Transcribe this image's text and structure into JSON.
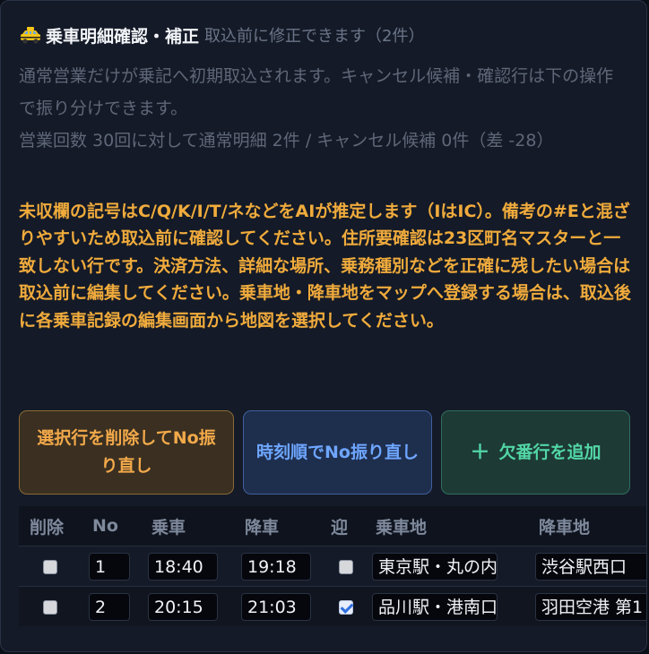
{
  "header": {
    "icon": "taxi-icon",
    "title": "乗車明細確認・補正",
    "subtitle": "取込前に修正できます（2件）"
  },
  "description": {
    "line1": "通常営業だけが乗記へ初期取込されます。キャンセル候補・確認行は下の操作で振り分けできます。",
    "line2": "営業回数 30回に対して通常明細 2件 / キャンセル候補 0件（差 -28）"
  },
  "warning": "未収欄の記号はC/Q/K/I/T/ネなどをAIが推定します（IはIC）。備考の#Eと混ざりやすいため取込前に確認してください。住所要確認は23区町名マスターと一致しない行です。決済方法、詳細な場所、乗務種別などを正確に残したい場合は取込前に編集してください。乗車地・降車地をマップへ登録する場合は、取込後に各乗車記録の編集画面から地図を選択してください。",
  "buttons": {
    "delete_renumber": "選択行を削除してNo振り直し",
    "sort_renumber": "時刻順でNo振り直し",
    "add_missing": "欠番行を追加",
    "add_icon": "plus-icon"
  },
  "table": {
    "headers": [
      "削除",
      "No",
      "乗車",
      "降車",
      "迎",
      "乗車地",
      "降車地"
    ],
    "rows": [
      {
        "delete": false,
        "no": "1",
        "board": "18:40",
        "alight": "19:18",
        "pickup": false,
        "from": "東京駅・丸の内",
        "to": "渋谷駅西口"
      },
      {
        "delete": false,
        "no": "2",
        "board": "20:15",
        "alight": "21:03",
        "pickup": true,
        "from": "品川駅・港南口",
        "to": "羽田空港 第1"
      }
    ]
  },
  "colors": {
    "panel_bg": "#141a27",
    "warning": "#f0ab3c",
    "delete_btn": "#f2a94a",
    "sort_btn": "#6ea6ff",
    "add_btn": "#52d6a6"
  }
}
